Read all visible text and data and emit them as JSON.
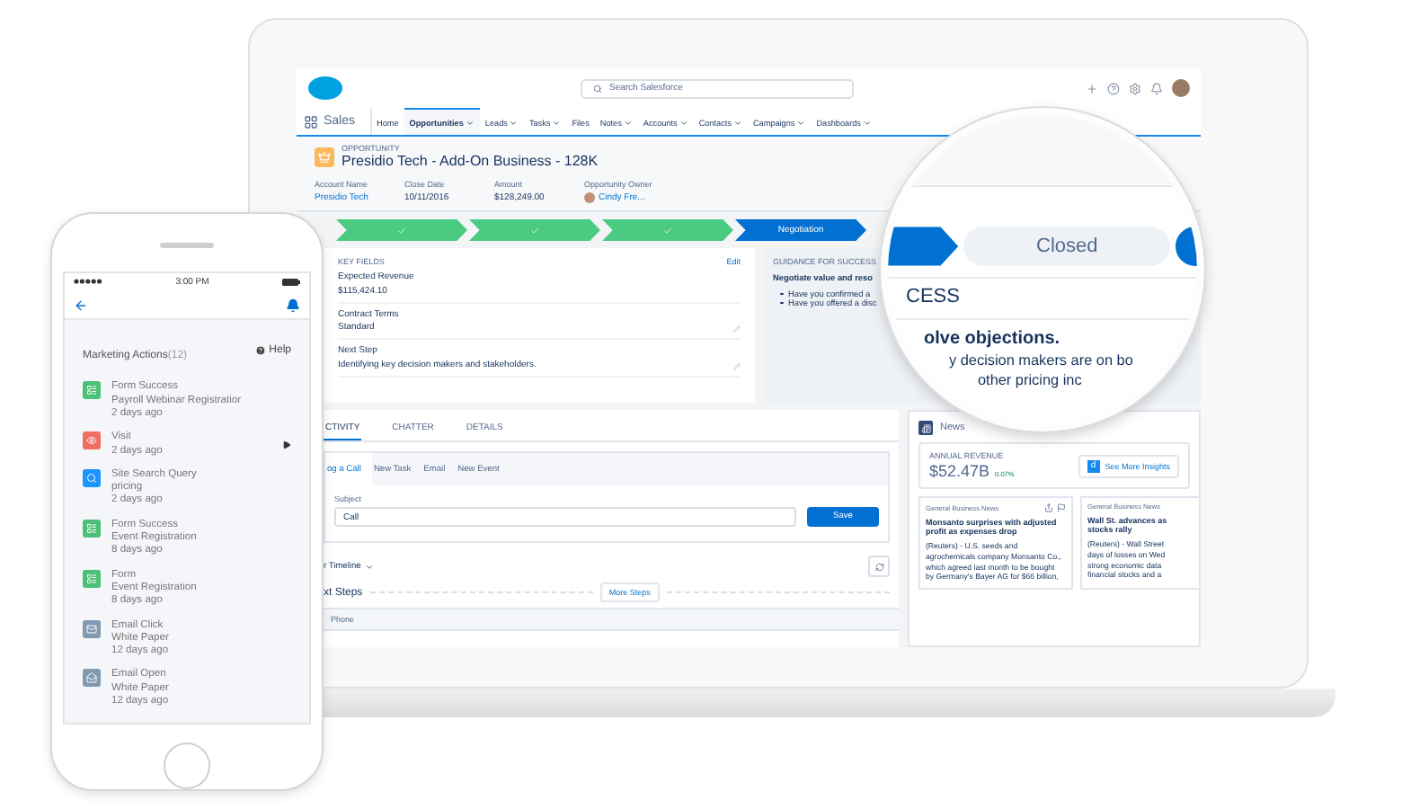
{
  "laptop": {
    "search_placeholder": "Search Salesforce",
    "app_name": "Sales",
    "nav": [
      {
        "label": "Home",
        "selected": false,
        "menu": false
      },
      {
        "label": "Opportunities",
        "selected": true,
        "menu": true
      },
      {
        "label": "Leads",
        "selected": false,
        "menu": true
      },
      {
        "label": "Tasks",
        "selected": false,
        "menu": true
      },
      {
        "label": "Files",
        "selected": false,
        "menu": false
      },
      {
        "label": "Notes",
        "selected": false,
        "menu": true
      },
      {
        "label": "Accounts",
        "selected": false,
        "menu": true
      },
      {
        "label": "Contacts",
        "selected": false,
        "menu": true
      },
      {
        "label": "Campaigns",
        "selected": false,
        "menu": true
      },
      {
        "label": "Dashboards",
        "selected": false,
        "menu": true
      }
    ],
    "record": {
      "type_label": "OPPORTUNITY",
      "title": "Presidio Tech - Add-On Business - 128K",
      "fields": [
        {
          "label": "Account Name",
          "value": "Presidio Tech",
          "kind": "link"
        },
        {
          "label": "Close Date",
          "value": "10/11/2016",
          "kind": "text"
        },
        {
          "label": "Amount",
          "value": "$128,249.00",
          "kind": "text"
        },
        {
          "label": "Opportunity Owner",
          "value": "Cindy Fre...",
          "kind": "owner"
        }
      ]
    },
    "path": [
      {
        "kind": "complete"
      },
      {
        "kind": "complete"
      },
      {
        "kind": "complete"
      },
      {
        "kind": "current",
        "label": "Negotiation"
      }
    ],
    "key_fields": {
      "heading": "KEY FIELDS",
      "edit": "Edit",
      "fields": [
        {
          "label": "Expected Revenue",
          "value": "$115,424.10",
          "editable": false
        },
        {
          "label": "Contract Terms",
          "value": "Standard",
          "editable": true
        },
        {
          "label": "Next Step",
          "value": "Identifying key decision makers and stakeholders.",
          "editable": true
        }
      ]
    },
    "guidance": {
      "heading": "GUIDANCE FOR SUCCESS",
      "subheading": "Negotiate value and reso",
      "bullets": [
        "Have you confirmed a",
        "Have you offered a disc"
      ]
    },
    "activity": {
      "tabs": [
        {
          "label": "CTIVITY",
          "selected": true
        },
        {
          "label": "CHATTER",
          "selected": false
        },
        {
          "label": "DETAILS",
          "selected": false
        }
      ],
      "composer_tabs": [
        {
          "label": "og a Call",
          "selected": true
        },
        {
          "label": "New Task",
          "selected": false
        },
        {
          "label": "Email",
          "selected": false
        },
        {
          "label": "New Event",
          "selected": false
        }
      ],
      "subject_label": "Subject",
      "subject_value": "Call",
      "save": "Save",
      "timeline_filter": "r Timeline",
      "next_steps": "xt Steps",
      "more_steps": "More Steps",
      "row": "Phone"
    },
    "news": {
      "title": "News",
      "revenue_label": "ANNUAL REVENUE",
      "revenue": "$52.47B",
      "change": "0.07%",
      "insights_logo": "d",
      "insights": "See More Insights",
      "articles": [
        {
          "source": "General Business News",
          "headline": "Monsanto surprises with adjusted profit as expenses drop",
          "lines": [
            "(Reuters) - U.S. seeds and",
            "agrochemicals company Monsanto Co.,",
            "which agreed last month to be bought",
            "by Germany's Bayer AG for $66 billion,"
          ]
        },
        {
          "source": "General Business News",
          "headline": "Wall St. advances as stocks rally",
          "lines": [
            "(Reuters) - Wall Street",
            "days of losses on Wed",
            "strong economic data",
            "financial stocks and a"
          ]
        }
      ]
    }
  },
  "magnifier": {
    "path_step": "Closed",
    "heading": "CESS",
    "lines": [
      {
        "text": "olve objections.",
        "bold": true
      },
      {
        "text": "y decision makers are on bo",
        "bold": false
      },
      {
        "text": "other pricing inc",
        "bold": false
      }
    ]
  },
  "phone": {
    "time": "3:00 PM",
    "title": "Marketing Actions",
    "count": "(12)",
    "help": "Help",
    "items": [
      {
        "kind": "form",
        "lines": [
          "Form Success",
          "Payroll Webinar Registratior",
          "2 days ago"
        ],
        "expandable": false
      },
      {
        "kind": "visit",
        "lines": [
          "Visit",
          "2 days ago"
        ],
        "expandable": true
      },
      {
        "kind": "search",
        "lines": [
          "Site Search Query",
          "pricing",
          "2 days ago"
        ],
        "expandable": false
      },
      {
        "kind": "form",
        "lines": [
          "Form Success",
          "Event Registration",
          "8 days ago"
        ],
        "expandable": false
      },
      {
        "kind": "form",
        "lines": [
          "Form",
          "Event Registration",
          "8 days ago"
        ],
        "expandable": false
      },
      {
        "kind": "email-click",
        "lines": [
          "Email Click",
          "White Paper",
          "12 days ago"
        ],
        "expandable": false
      },
      {
        "kind": "email-open",
        "lines": [
          "Email Open",
          "White Paper",
          "12 days ago"
        ],
        "expandable": false
      }
    ]
  }
}
